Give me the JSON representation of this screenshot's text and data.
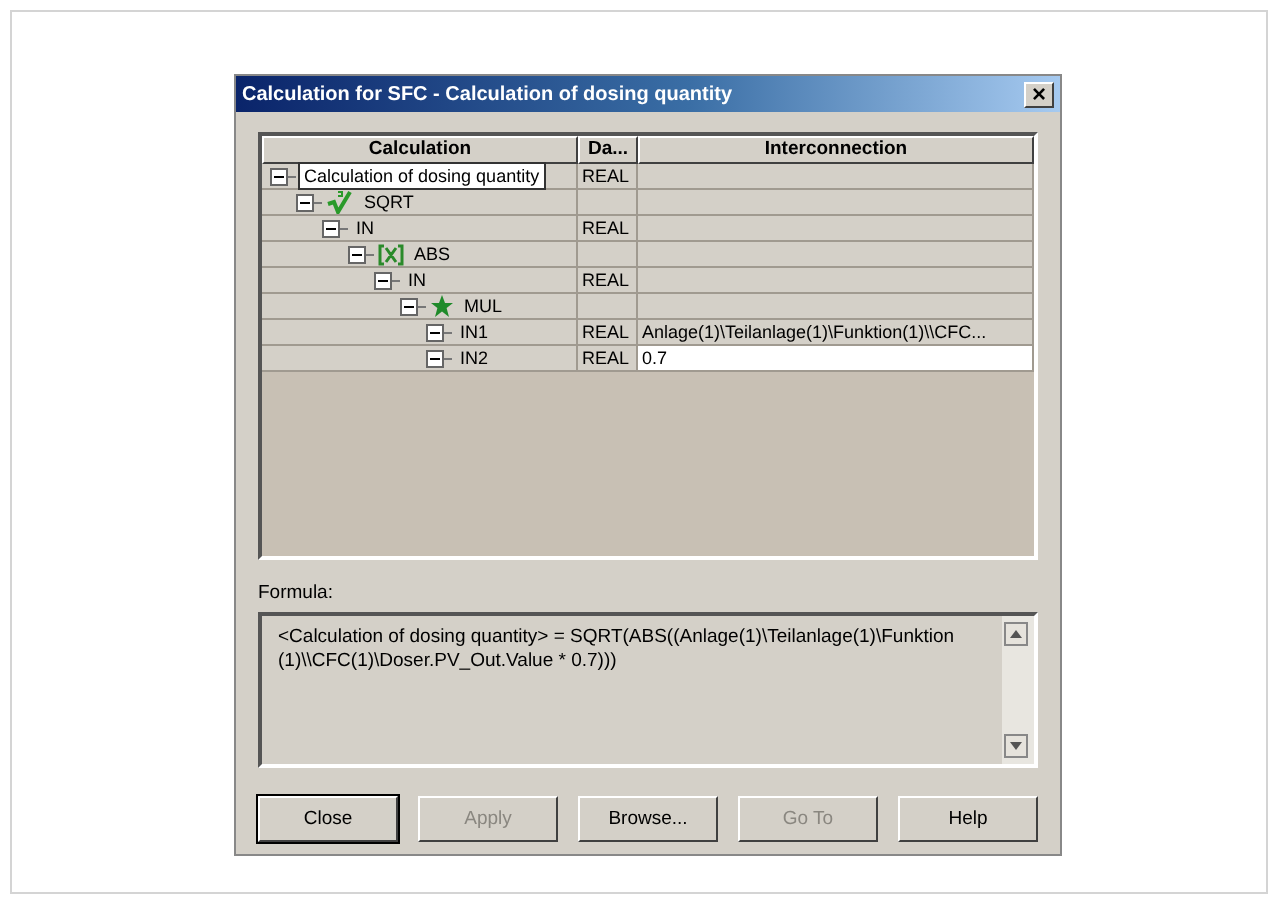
{
  "window": {
    "title": "Calculation for SFC - Calculation of dosing quantity",
    "close_glyph": "×"
  },
  "table": {
    "columns": [
      "Calculation",
      "Da...",
      "Interconnection"
    ],
    "tree": [
      {
        "label": "Calculation of dosing quantity",
        "expanded": true,
        "selected": true,
        "data_type": "REAL",
        "children": [
          {
            "label": "SQRT",
            "kind": "sqrt",
            "expanded": true,
            "selected": false,
            "children": [
              {
                "label": "IN",
                "expanded": true,
                "selected": false,
                "data_type": "REAL",
                "children": [
                  {
                    "label": "ABS",
                    "kind": "abs",
                    "expanded": true,
                    "selected": false,
                    "children": [
                      {
                        "label": "IN",
                        "expanded": true,
                        "selected": false,
                        "data_type": "REAL",
                        "children": [
                          {
                            "label": "MUL",
                            "kind": "mul",
                            "expanded": true,
                            "selected": false,
                            "children": [
                              {
                                "label": "IN1",
                                "expanded": true,
                                "selected": false,
                                "data_type": "REAL",
                                "interconnection": "Anlage(1)\\Teilanlage(1)\\Funktion(1)\\\\CFC...",
                                "editing": false
                              },
                              {
                                "label": "IN2",
                                "expanded": true,
                                "selected": false,
                                "data_type": "REAL",
                                "interconnection": "0.7",
                                "editing": true
                              }
                            ]
                          }
                        ]
                      }
                    ]
                  }
                ]
              }
            ]
          }
        ]
      }
    ]
  },
  "formula": {
    "label": "Formula:",
    "value": "<Calculation of dosing quantity> = SQRT(ABS((Anlage(1)\\Teilanlage(1)\\Funktion (1)\\\\CFC(1)\\Doser.PV_Out.Value * 0.7)))"
  },
  "buttons": [
    {
      "label": "Close",
      "disabled": false,
      "default": true
    },
    {
      "label": "Apply",
      "disabled": true,
      "default": false
    },
    {
      "label": "Browse...",
      "disabled": false,
      "default": false
    },
    {
      "label": "Go To",
      "disabled": true,
      "default": false
    },
    {
      "label": "Help",
      "disabled": false,
      "default": false
    }
  ]
}
